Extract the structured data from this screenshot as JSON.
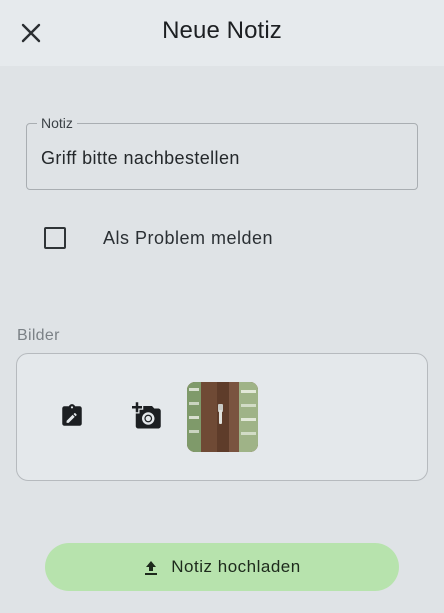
{
  "header": {
    "title": "Neue Notiz",
    "close_icon": "close-icon"
  },
  "note_field": {
    "label": "Notiz",
    "value": "Griff bitte nachbestellen"
  },
  "problem_checkbox": {
    "label": "Als Problem melden",
    "checked": false
  },
  "images": {
    "section_label": "Bilder",
    "edit_icon": "edit-clipboard-icon",
    "camera_icon": "add-camera-icon",
    "thumbnail_count": 1
  },
  "upload_button": {
    "label": "Notiz hochladen",
    "icon": "upload-icon",
    "color": "#b7e3ad"
  },
  "colors": {
    "background": "#dfe3e6",
    "topbar": "#e6eaed"
  }
}
